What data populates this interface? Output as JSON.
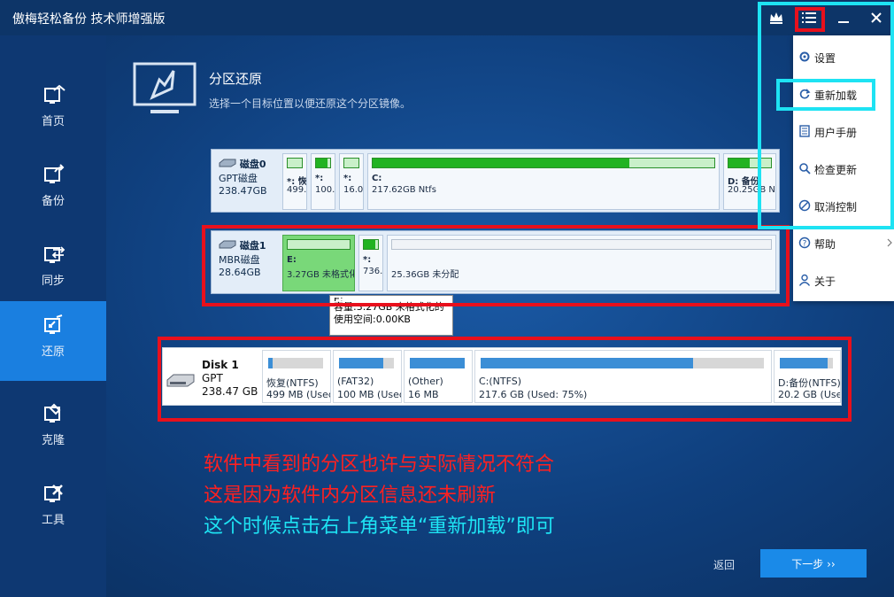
{
  "window": {
    "title": "傲梅轻松备份 技术师增强版"
  },
  "sidebar": {
    "items": [
      {
        "label": "首页"
      },
      {
        "label": "备份"
      },
      {
        "label": "同步"
      },
      {
        "label": "还原"
      },
      {
        "label": "克隆"
      },
      {
        "label": "工具"
      }
    ]
  },
  "page": {
    "title": "分区还原",
    "subtitle": "选择一个目标位置以便还原这个分区镜像。"
  },
  "disk0": {
    "name": "磁盘0",
    "type": "GPT磁盘",
    "size": "238.47GB",
    "partitions": [
      {
        "t1": "*: 恢",
        "t2": "499.",
        "used": 0.6
      },
      {
        "t1": "*:",
        "t2": "100.",
        "used": 0.8
      },
      {
        "t1": "*:",
        "t2": "16.0",
        "used": 0.0
      },
      {
        "t1": "C:",
        "t2": "217.62GB Ntfs",
        "used": 0.75
      },
      {
        "t1": "D: 备份",
        "t2": "20.25GB Nt",
        "used": 0.5
      }
    ]
  },
  "disk1": {
    "name": "磁盘1",
    "type": "MBR磁盘",
    "size": "28.64GB",
    "partitions": [
      {
        "t1": "E:",
        "t2": "3.27GB 未格式化",
        "used": 0.0
      },
      {
        "t1": "*:",
        "t2": "736.",
        "used": 0.8
      },
      {
        "t1": "",
        "t2": "25.36GB 未分配",
        "used": 0.0
      }
    ]
  },
  "tooltip": {
    "line0": "E:",
    "line1": "容量:3.27GB 未格式化的",
    "line2": "使用空间:0.00KB"
  },
  "disk2": {
    "name": "Disk 1",
    "type": "GPT",
    "size": "238.47 GB",
    "partitions": [
      {
        "t1": "恢复(NTFS)",
        "t2": "499 MB (Used",
        "used": 0.08
      },
      {
        "t1": "(FAT32)",
        "t2": "100 MB (Used",
        "used": 0.8
      },
      {
        "t1": "(Other)",
        "t2": "16 MB",
        "used": 1.0
      },
      {
        "t1": "C:(NTFS)",
        "t2": "217.6 GB (Used: 75%)",
        "used": 0.75
      },
      {
        "t1": "D:备份(NTFS)",
        "t2": "20.2 GB (Use",
        "used": 0.9
      }
    ]
  },
  "notes": {
    "line1": "软件中看到的分区也许与实际情况不符合",
    "line2": "这是因为软件内分区信息还未刷新",
    "line3": "这个时候点击右上角菜单“重新加载”即可"
  },
  "footer": {
    "back": "返回",
    "next": "下一步 ››"
  },
  "menu": {
    "items": [
      {
        "label": "设置"
      },
      {
        "label": "重新加载"
      },
      {
        "label": "用户手册"
      },
      {
        "label": "检查更新"
      },
      {
        "label": "取消控制"
      },
      {
        "label": "帮助"
      },
      {
        "label": "关于"
      }
    ]
  },
  "colors": {
    "annotation_red": "#e8101c",
    "annotation_cyan": "#1ee3f3",
    "accent": "#1a8ae8"
  }
}
